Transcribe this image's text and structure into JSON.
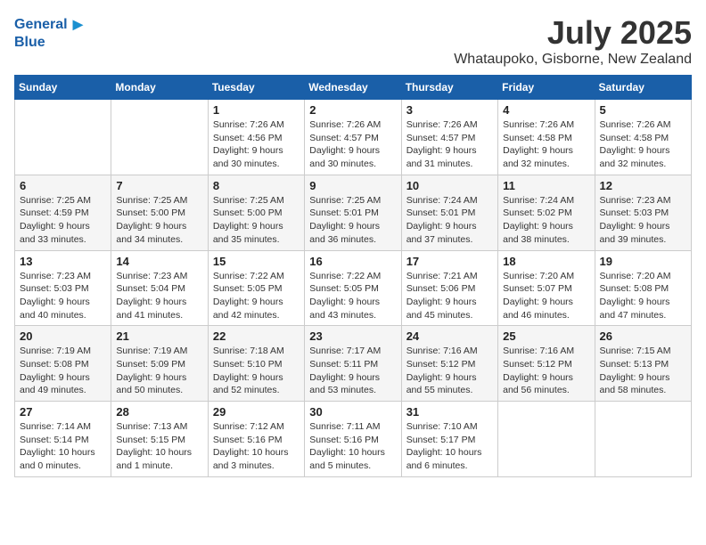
{
  "header": {
    "logo_line1": "General",
    "logo_line2": "Blue",
    "month": "July 2025",
    "location": "Whataupoko, Gisborne, New Zealand"
  },
  "days_of_week": [
    "Sunday",
    "Monday",
    "Tuesday",
    "Wednesday",
    "Thursday",
    "Friday",
    "Saturday"
  ],
  "weeks": [
    [
      {
        "day": "",
        "content": ""
      },
      {
        "day": "",
        "content": ""
      },
      {
        "day": "1",
        "content": "Sunrise: 7:26 AM\nSunset: 4:56 PM\nDaylight: 9 hours\nand 30 minutes."
      },
      {
        "day": "2",
        "content": "Sunrise: 7:26 AM\nSunset: 4:57 PM\nDaylight: 9 hours\nand 30 minutes."
      },
      {
        "day": "3",
        "content": "Sunrise: 7:26 AM\nSunset: 4:57 PM\nDaylight: 9 hours\nand 31 minutes."
      },
      {
        "day": "4",
        "content": "Sunrise: 7:26 AM\nSunset: 4:58 PM\nDaylight: 9 hours\nand 32 minutes."
      },
      {
        "day": "5",
        "content": "Sunrise: 7:26 AM\nSunset: 4:58 PM\nDaylight: 9 hours\nand 32 minutes."
      }
    ],
    [
      {
        "day": "6",
        "content": "Sunrise: 7:25 AM\nSunset: 4:59 PM\nDaylight: 9 hours\nand 33 minutes."
      },
      {
        "day": "7",
        "content": "Sunrise: 7:25 AM\nSunset: 5:00 PM\nDaylight: 9 hours\nand 34 minutes."
      },
      {
        "day": "8",
        "content": "Sunrise: 7:25 AM\nSunset: 5:00 PM\nDaylight: 9 hours\nand 35 minutes."
      },
      {
        "day": "9",
        "content": "Sunrise: 7:25 AM\nSunset: 5:01 PM\nDaylight: 9 hours\nand 36 minutes."
      },
      {
        "day": "10",
        "content": "Sunrise: 7:24 AM\nSunset: 5:01 PM\nDaylight: 9 hours\nand 37 minutes."
      },
      {
        "day": "11",
        "content": "Sunrise: 7:24 AM\nSunset: 5:02 PM\nDaylight: 9 hours\nand 38 minutes."
      },
      {
        "day": "12",
        "content": "Sunrise: 7:23 AM\nSunset: 5:03 PM\nDaylight: 9 hours\nand 39 minutes."
      }
    ],
    [
      {
        "day": "13",
        "content": "Sunrise: 7:23 AM\nSunset: 5:03 PM\nDaylight: 9 hours\nand 40 minutes."
      },
      {
        "day": "14",
        "content": "Sunrise: 7:23 AM\nSunset: 5:04 PM\nDaylight: 9 hours\nand 41 minutes."
      },
      {
        "day": "15",
        "content": "Sunrise: 7:22 AM\nSunset: 5:05 PM\nDaylight: 9 hours\nand 42 minutes."
      },
      {
        "day": "16",
        "content": "Sunrise: 7:22 AM\nSunset: 5:05 PM\nDaylight: 9 hours\nand 43 minutes."
      },
      {
        "day": "17",
        "content": "Sunrise: 7:21 AM\nSunset: 5:06 PM\nDaylight: 9 hours\nand 45 minutes."
      },
      {
        "day": "18",
        "content": "Sunrise: 7:20 AM\nSunset: 5:07 PM\nDaylight: 9 hours\nand 46 minutes."
      },
      {
        "day": "19",
        "content": "Sunrise: 7:20 AM\nSunset: 5:08 PM\nDaylight: 9 hours\nand 47 minutes."
      }
    ],
    [
      {
        "day": "20",
        "content": "Sunrise: 7:19 AM\nSunset: 5:08 PM\nDaylight: 9 hours\nand 49 minutes."
      },
      {
        "day": "21",
        "content": "Sunrise: 7:19 AM\nSunset: 5:09 PM\nDaylight: 9 hours\nand 50 minutes."
      },
      {
        "day": "22",
        "content": "Sunrise: 7:18 AM\nSunset: 5:10 PM\nDaylight: 9 hours\nand 52 minutes."
      },
      {
        "day": "23",
        "content": "Sunrise: 7:17 AM\nSunset: 5:11 PM\nDaylight: 9 hours\nand 53 minutes."
      },
      {
        "day": "24",
        "content": "Sunrise: 7:16 AM\nSunset: 5:12 PM\nDaylight: 9 hours\nand 55 minutes."
      },
      {
        "day": "25",
        "content": "Sunrise: 7:16 AM\nSunset: 5:12 PM\nDaylight: 9 hours\nand 56 minutes."
      },
      {
        "day": "26",
        "content": "Sunrise: 7:15 AM\nSunset: 5:13 PM\nDaylight: 9 hours\nand 58 minutes."
      }
    ],
    [
      {
        "day": "27",
        "content": "Sunrise: 7:14 AM\nSunset: 5:14 PM\nDaylight: 10 hours\nand 0 minutes."
      },
      {
        "day": "28",
        "content": "Sunrise: 7:13 AM\nSunset: 5:15 PM\nDaylight: 10 hours\nand 1 minute."
      },
      {
        "day": "29",
        "content": "Sunrise: 7:12 AM\nSunset: 5:16 PM\nDaylight: 10 hours\nand 3 minutes."
      },
      {
        "day": "30",
        "content": "Sunrise: 7:11 AM\nSunset: 5:16 PM\nDaylight: 10 hours\nand 5 minutes."
      },
      {
        "day": "31",
        "content": "Sunrise: 7:10 AM\nSunset: 5:17 PM\nDaylight: 10 hours\nand 6 minutes."
      },
      {
        "day": "",
        "content": ""
      },
      {
        "day": "",
        "content": ""
      }
    ]
  ]
}
